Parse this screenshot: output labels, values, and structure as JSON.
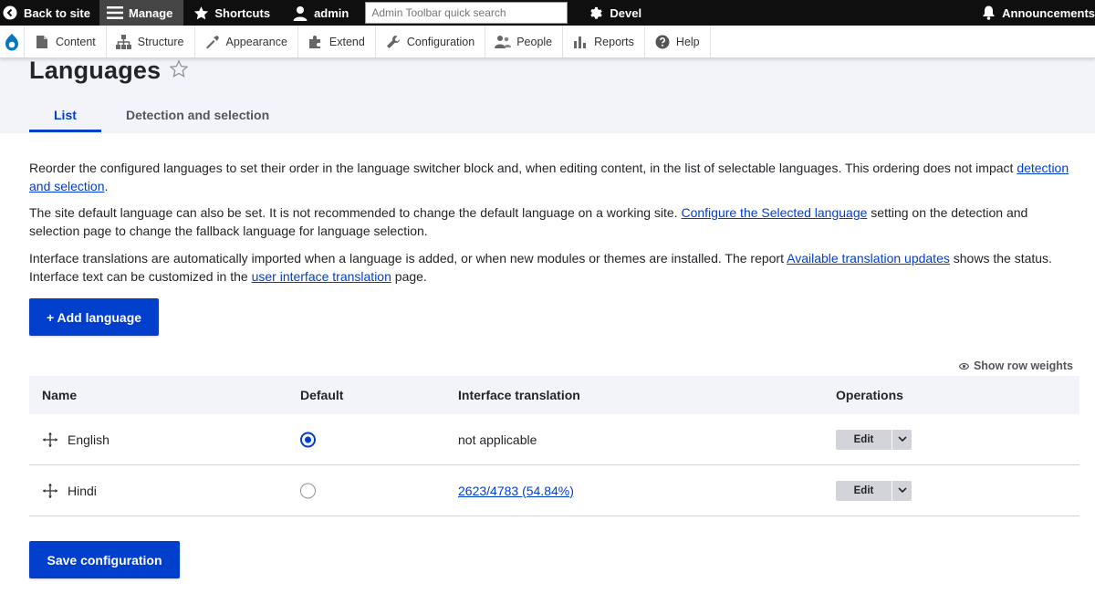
{
  "toolbar": {
    "back": "Back to site",
    "manage": "Manage",
    "shortcuts": "Shortcuts",
    "user": "admin",
    "search_placeholder": "Admin Toolbar quick search",
    "devel": "Devel",
    "announcements": "Announcements"
  },
  "menu": {
    "items": [
      {
        "label": "Content",
        "icon": "content-icon"
      },
      {
        "label": "Structure",
        "icon": "structure-icon"
      },
      {
        "label": "Appearance",
        "icon": "appearance-icon"
      },
      {
        "label": "Extend",
        "icon": "extend-icon"
      },
      {
        "label": "Configuration",
        "icon": "configuration-icon"
      },
      {
        "label": "People",
        "icon": "people-icon"
      },
      {
        "label": "Reports",
        "icon": "reports-icon"
      },
      {
        "label": "Help",
        "icon": "help-icon"
      }
    ]
  },
  "page": {
    "title": "Languages",
    "tabs": [
      {
        "label": "List",
        "active": true
      },
      {
        "label": "Detection and selection",
        "active": false
      }
    ]
  },
  "description": {
    "p1_text": "Reorder the configured languages to set their order in the language switcher block and, when editing content, in the list of selectable languages. This ordering does not impact ",
    "p1_link": "detection and selection",
    "p1_end": ".",
    "p2_text": "The site default language can also be set. It is not recommended to change the default language on a working site. ",
    "p2_link": "Configure the Selected language",
    "p2_end": " setting on the detection and selection page to change the fallback language for language selection.",
    "p3_text": "Interface translations are automatically imported when a language is added, or when new modules or themes are installed. The report ",
    "p3_link1": "Available translation updates",
    "p3_mid": " shows the status. Interface text can be customized in the ",
    "p3_link2": "user interface translation",
    "p3_end": " page."
  },
  "add_language_label": "+ Add language",
  "show_row_weights": "Show row weights",
  "table": {
    "headers": {
      "name": "Name",
      "default": "Default",
      "interface": "Interface translation",
      "operations": "Operations"
    },
    "rows": [
      {
        "name": "English",
        "default": true,
        "interface": "not applicable",
        "op": "Edit"
      },
      {
        "name": "Hindi",
        "default": false,
        "interface": "2623/4783 (54.84%)",
        "op": "Edit"
      }
    ]
  },
  "save_label": "Save configuration",
  "colors": {
    "accent": "#003ecc",
    "toolbar": "#0f0f0f",
    "header_bg": "#f3f4f9"
  }
}
